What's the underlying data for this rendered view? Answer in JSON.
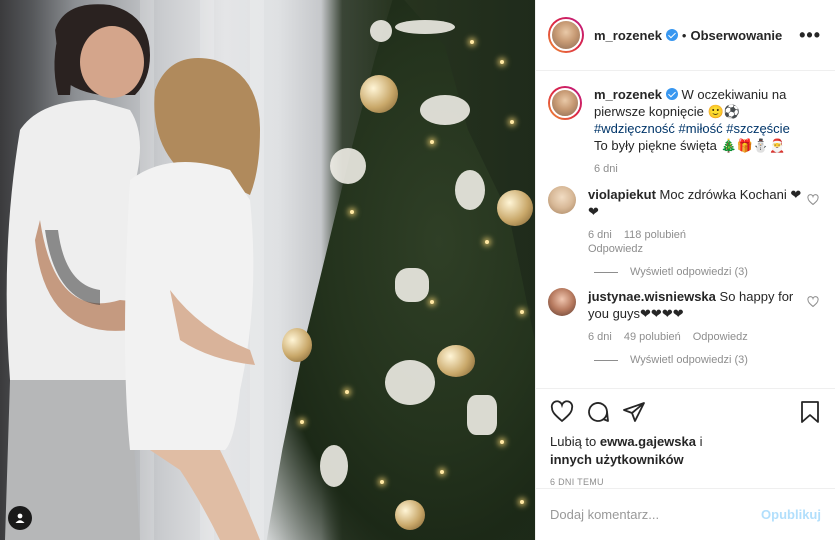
{
  "post": {
    "username": "m_rozenek",
    "follow_label": "Obserwowanie",
    "separator": "•",
    "more_label": "•••",
    "caption_text": "W oczekiwaniu na pierwsze kopnięcie 🙂⚽",
    "caption_tags": "#wdzięczność #miłość #szczęście",
    "caption_tail": "To były piękne święta 🎄🎁⛄🎅",
    "caption_age": "6 dni"
  },
  "comments": [
    {
      "username": "violapiekut",
      "text": "Moc zdrówka Kochani ❤❤",
      "age": "6 dni",
      "likes": "118 polubień",
      "reply": "Odpowiedz",
      "view_replies": "Wyświetl odpowiedzi (3)"
    },
    {
      "username": "justynae.wisniewska",
      "text": "So happy for you guys❤❤❤❤",
      "age": "6 dni",
      "likes": "49 polubień",
      "reply": "Odpowiedz",
      "view_replies": "Wyświetl odpowiedzi (3)"
    }
  ],
  "likes": {
    "prefix": "Lubią to ",
    "user": "ewwa.gajewska",
    "middle": " i",
    "others": "innych użytkowników"
  },
  "timestamp": "6 DNI TEMU",
  "add_comment": {
    "placeholder": "Dodaj komentarz...",
    "publish": "Opublikuj"
  },
  "colors": {
    "link": "#003569",
    "verified": "#3897f0",
    "muted": "#8e8e8e",
    "publish_disabled": "#b2dffc",
    "heart": "#e0245e"
  }
}
